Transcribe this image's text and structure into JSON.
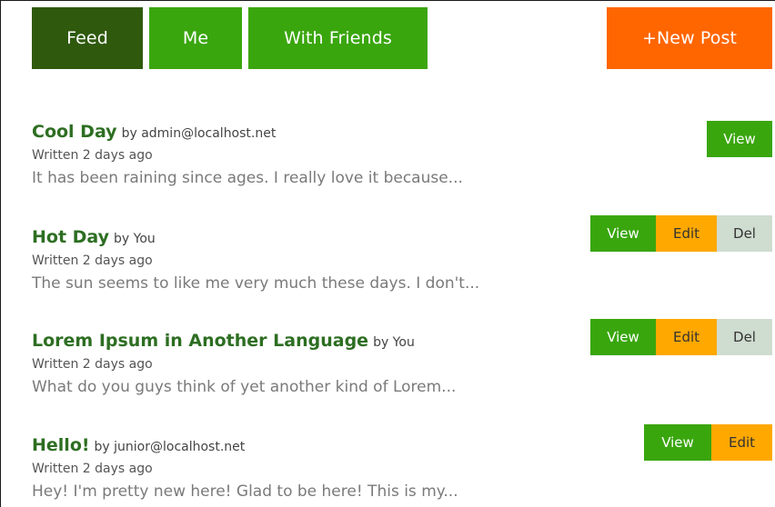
{
  "nav": {
    "feed": "Feed",
    "me": "Me",
    "with_friends": "With Friends",
    "new_post": "+New Post"
  },
  "colors": {
    "active_tab": "#2f5a0d",
    "tab": "#3aa60e",
    "new_post": "#ff6600",
    "view_button": "#3aa60e",
    "edit_button": "#ffa800",
    "del_button": "#cfdcd0",
    "post_title": "#2d6e22"
  },
  "posts": [
    {
      "title": "Cool Day",
      "by": "by admin@localhost.net",
      "written": "Written 2 days ago",
      "excerpt": "It has been raining since ages. I really love it because...",
      "view_label": "View"
    },
    {
      "title": "Hot Day",
      "by": "by You",
      "written": "Written 2 days ago",
      "excerpt": "The sun seems to like me very much these days. I don't...",
      "view_label": "View",
      "edit_label": "Edit",
      "del_label": "Del"
    },
    {
      "title": "Lorem Ipsum in Another Language",
      "by": "by You",
      "written": "Written 2 days ago",
      "excerpt": "What do you guys think of yet another kind of Lorem...",
      "view_label": "View",
      "edit_label": "Edit",
      "del_label": "Del"
    },
    {
      "title": "Hello!",
      "by": "by junior@localhost.net",
      "written": "Written 2 days ago",
      "excerpt": "Hey! I'm pretty new here! Glad to be here! This is my...",
      "view_label": "View",
      "edit_label": "Edit"
    }
  ]
}
